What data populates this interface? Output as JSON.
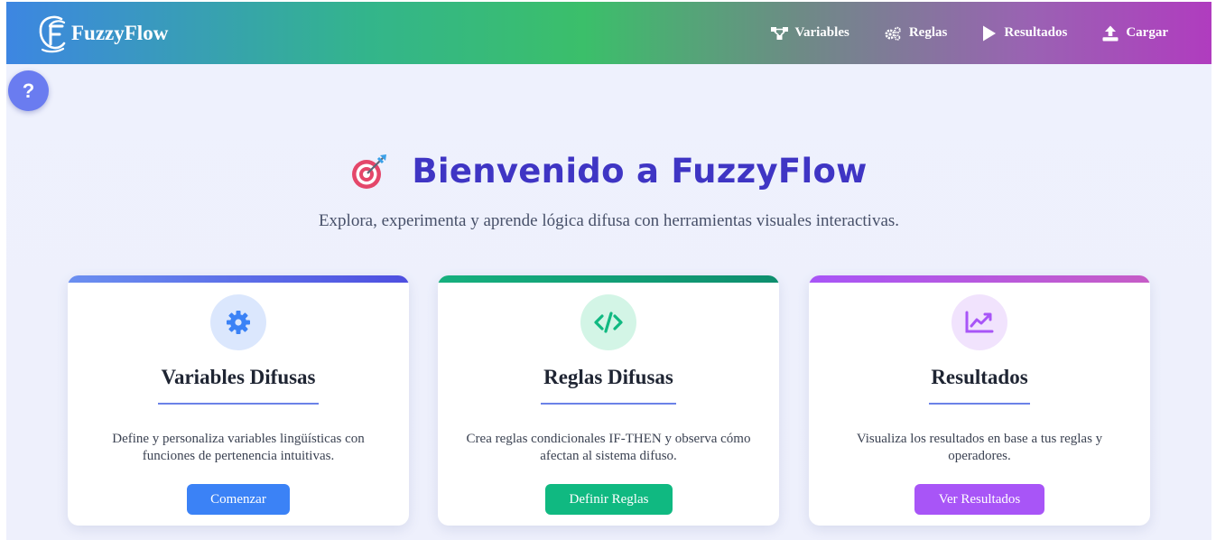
{
  "app": {
    "name": "FuzzyFlow"
  },
  "nav": {
    "items": [
      {
        "label": "Variables",
        "icon": "network-nodes-icon"
      },
      {
        "label": "Reglas",
        "icon": "gears-icon"
      },
      {
        "label": "Resultados",
        "icon": "play-icon"
      },
      {
        "label": "Cargar",
        "icon": "upload-icon"
      }
    ]
  },
  "help": {
    "label": "?"
  },
  "hero": {
    "title": "Bienvenido a FuzzyFlow",
    "icon": "target-dart-icon",
    "subtitle": "Explora, experimenta y aprende lógica difusa con herramientas visuales interactivas."
  },
  "cards": [
    {
      "title": "Variables Difusas",
      "icon": "gear-icon",
      "description": "Define y personaliza variables lingüísticas con funciones de pertenencia intuitivas.",
      "button": "Comenzar",
      "accent": "#3b82f6"
    },
    {
      "title": "Reglas Difusas",
      "icon": "code-icon",
      "description": "Crea reglas condicionales IF-THEN y observa cómo afectan al sistema difuso.",
      "button": "Definir Reglas",
      "accent": "#10b981"
    },
    {
      "title": "Resultados",
      "icon": "chart-line-icon",
      "description": "Visualiza los resultados en base a tus reglas y operadores.",
      "button": "Ver Resultados",
      "accent": "#a855f7"
    }
  ]
}
